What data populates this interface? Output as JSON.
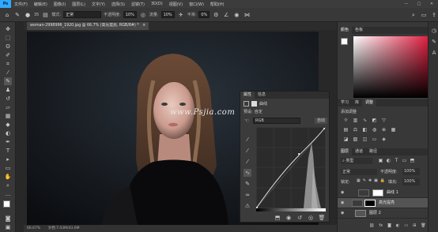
{
  "app": {
    "logo": "Ps"
  },
  "menu": {
    "items": [
      "文件(F)",
      "编辑(E)",
      "图像(I)",
      "图层(L)",
      "文字(Y)",
      "选择(S)",
      "滤镜(T)",
      "3D(D)",
      "视图(V)",
      "窗口(W)",
      "帮助(H)"
    ]
  },
  "window_controls": {
    "minimize": "—",
    "maximize": "□",
    "close": "✕"
  },
  "options": {
    "brush_size": "35",
    "mode_label": "模式:",
    "mode_value": "正常",
    "opacity_label": "不透明度:",
    "opacity_value": "10%",
    "flow_label": "流量:",
    "flow_value": "10%",
    "smooth_label": "平滑:",
    "smooth_value": "0%"
  },
  "document": {
    "tab_title": "woman-2998996_1920.jpg @ 66.7% (高光提亮, RGB/8#) *",
    "tab_close": "×",
    "zoom": "66.67%",
    "doc_info": "文档:7.03M/43.6M"
  },
  "watermark": "www.Psjia.com",
  "properties": {
    "tabs": [
      "属性",
      "信息"
    ],
    "title": "曲线",
    "preset_label": "预设:",
    "preset_value": "自定",
    "channel": "RGB",
    "auto_label": "自动"
  },
  "right_panel": {
    "color_tabs": [
      "颜色",
      "色板"
    ],
    "mid_tabs": [
      "学习",
      "库",
      "调整"
    ],
    "add_adjustment": "添加调整",
    "layer_tabs": [
      "图层",
      "通道",
      "路径"
    ],
    "kind_label": "类型",
    "blend_mode": "正常",
    "opacity_label": "不透明度:",
    "opacity_value": "100%",
    "lock_label": "锁定:",
    "fill_label": "填充:",
    "fill_value": "100%",
    "layers": [
      {
        "name": "曲线 1"
      },
      {
        "name": "高光提亮"
      },
      {
        "name": "图层 2"
      }
    ]
  },
  "icons": {
    "brush": "brush-icon",
    "move": "move-icon",
    "eye": "eye-icon"
  },
  "colors": {
    "accent": "#31a8ff",
    "panel": "#383838",
    "canvas": "#0f1114"
  }
}
